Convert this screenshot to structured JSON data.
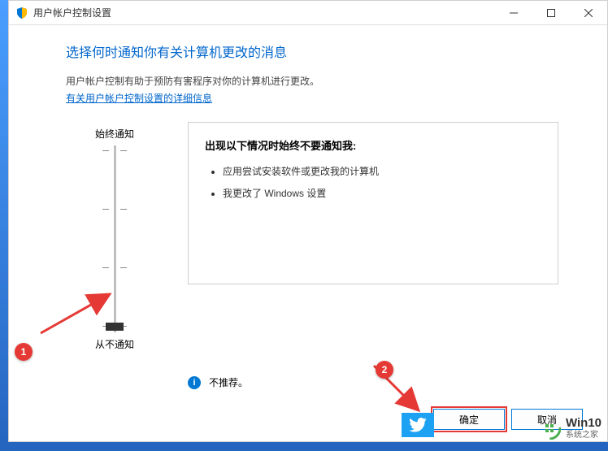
{
  "titlebar": {
    "title": "用户帐户控制设置"
  },
  "content": {
    "heading": "选择何时通知你有关计算机更改的消息",
    "subtext": "用户帐户控制有助于预防有害程序对你的计算机进行更改。",
    "link": "有关用户帐户控制设置的详细信息"
  },
  "slider": {
    "top_label": "始终通知",
    "bottom_label": "从不通知"
  },
  "info": {
    "title": "出现以下情况时始终不要通知我:",
    "items": [
      "应用尝试安装软件或更改我的计算机",
      "我更改了 Windows 设置"
    ]
  },
  "warning": "不推荐。",
  "buttons": {
    "ok": "确定",
    "cancel": "取消"
  },
  "annotations": {
    "n1": "1",
    "n2": "2"
  },
  "watermark": {
    "big": "Win10",
    "small": "系统之家"
  }
}
